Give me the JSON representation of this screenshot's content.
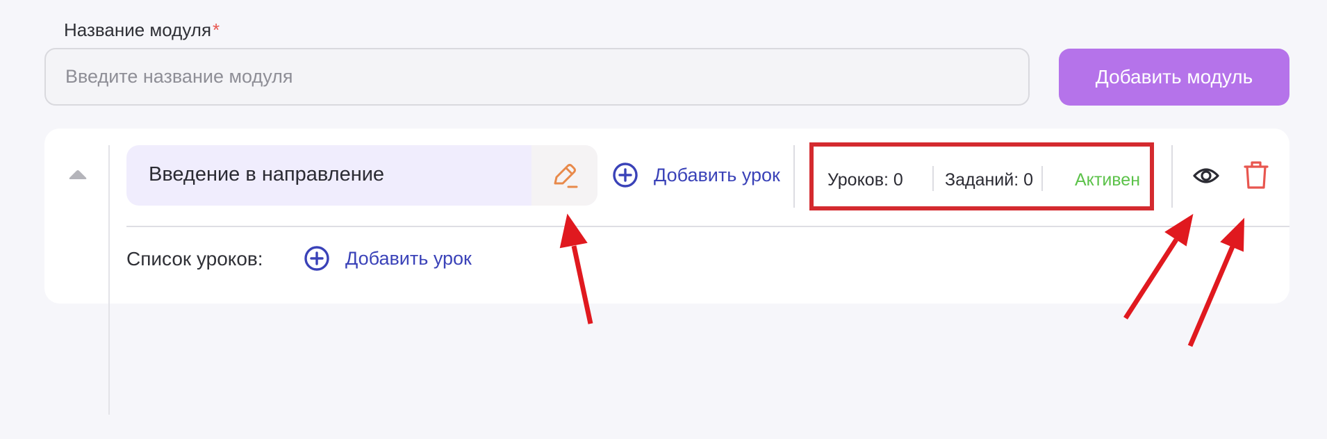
{
  "form": {
    "label": "Название модуля",
    "required_mark": "*",
    "input_placeholder": "Введите название модуля",
    "input_value": "",
    "add_module_label": "Добавить модуль"
  },
  "module": {
    "title": "Введение в направление",
    "add_lesson_label": "Добавить урок",
    "stats": {
      "lessons": "Уроков: 0",
      "tasks": "Заданий: 0",
      "status": "Активен"
    },
    "lessons_list_label": "Список уроков:",
    "lessons_add_label": "Добавить урок"
  },
  "icons": {
    "collapse": "caret-up-icon",
    "edit": "pencil-icon",
    "add": "plus-circle-icon",
    "view": "eye-icon",
    "delete": "trash-icon"
  },
  "colors": {
    "accent": "#b573ea",
    "link": "#3a42b8",
    "status_active": "#5cc24a",
    "delete": "#e8564f",
    "edit": "#e8894a",
    "highlight": "#d42a2f",
    "annotation_arrow": "#e0191f"
  }
}
